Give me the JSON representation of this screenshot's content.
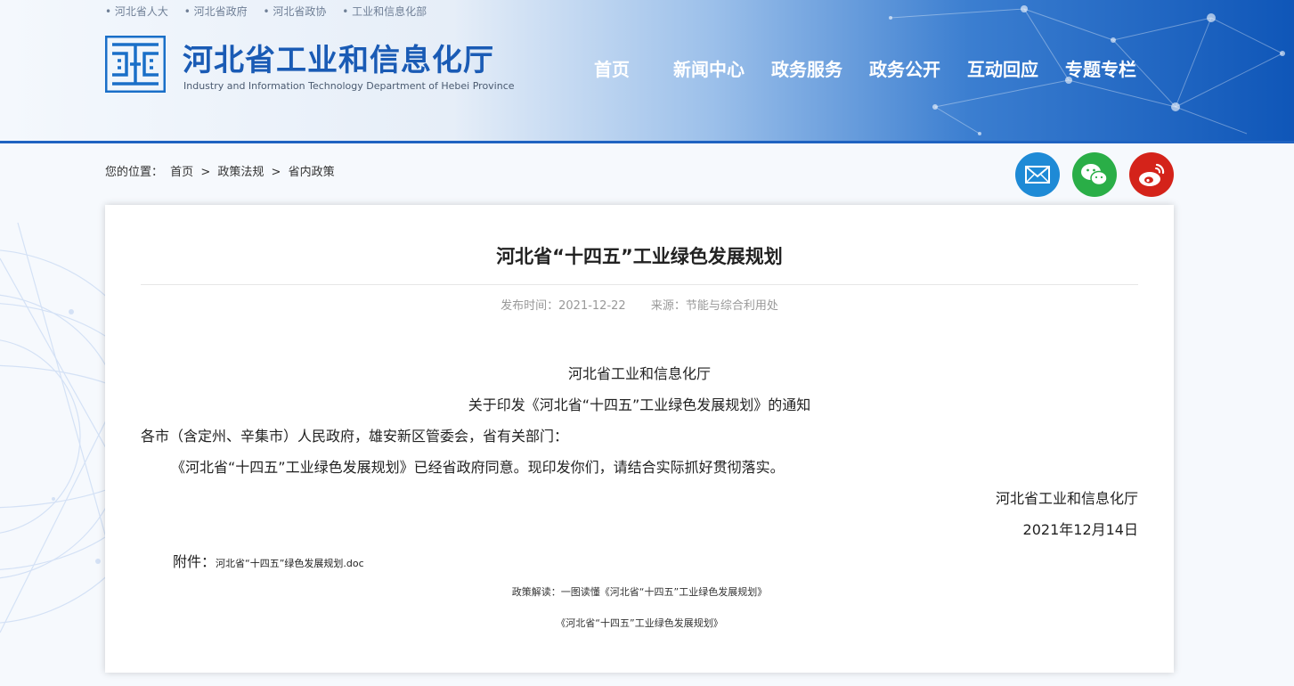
{
  "top_links": [
    "• 河北省人大",
    "• 河北省政府",
    "• 河北省政协",
    "• 工业和信息化部"
  ],
  "logo": {
    "icon": "hebei-seal-logo-icon",
    "title": "河北省工业和信息化厅",
    "subtitle": "Industry and Information Technology Department of Hebei Province"
  },
  "nav": [
    "首页",
    "新闻中心",
    "政务服务",
    "政务公开",
    "互动回应",
    "专题专栏"
  ],
  "breadcrumb": {
    "label": "您的位置：",
    "items": [
      "首页",
      ">",
      "政策法规",
      ">",
      "省内政策"
    ]
  },
  "share": [
    {
      "name": "mail-icon",
      "color": "#1e8ad6"
    },
    {
      "name": "wechat-icon",
      "color": "#2aae47"
    },
    {
      "name": "weibo-icon",
      "color": "#d4231a"
    }
  ],
  "article": {
    "title": "河北省“十四五”工业绿色发展规划",
    "publish_time": "发布时间：2021-12-22",
    "source": "来源：节能与综合利用处",
    "issuer": "河北省工业和信息化厅",
    "notice_title": "关于印发《河北省“十四五”工业绿色发展规划》的通知",
    "recipients": "各市（含定州、辛集市）人民政府，雄安新区管委会，省有关部门：",
    "body": "《河北省“十四五”工业绿色发展规划》已经省政府同意。现印发你们，请结合实际抓好贯彻落实。",
    "signature": "河北省工业和信息化厅",
    "date": "2021年12月14日",
    "attachment_label": "附件：",
    "attachment_file": "河北省“十四五”绿色发展规划.doc",
    "interpretation": "政策解读：一图读懂《河北省“十四五”工业绿色发展规划》",
    "related": "《河北省“十四五”工业绿色发展规划》"
  }
}
